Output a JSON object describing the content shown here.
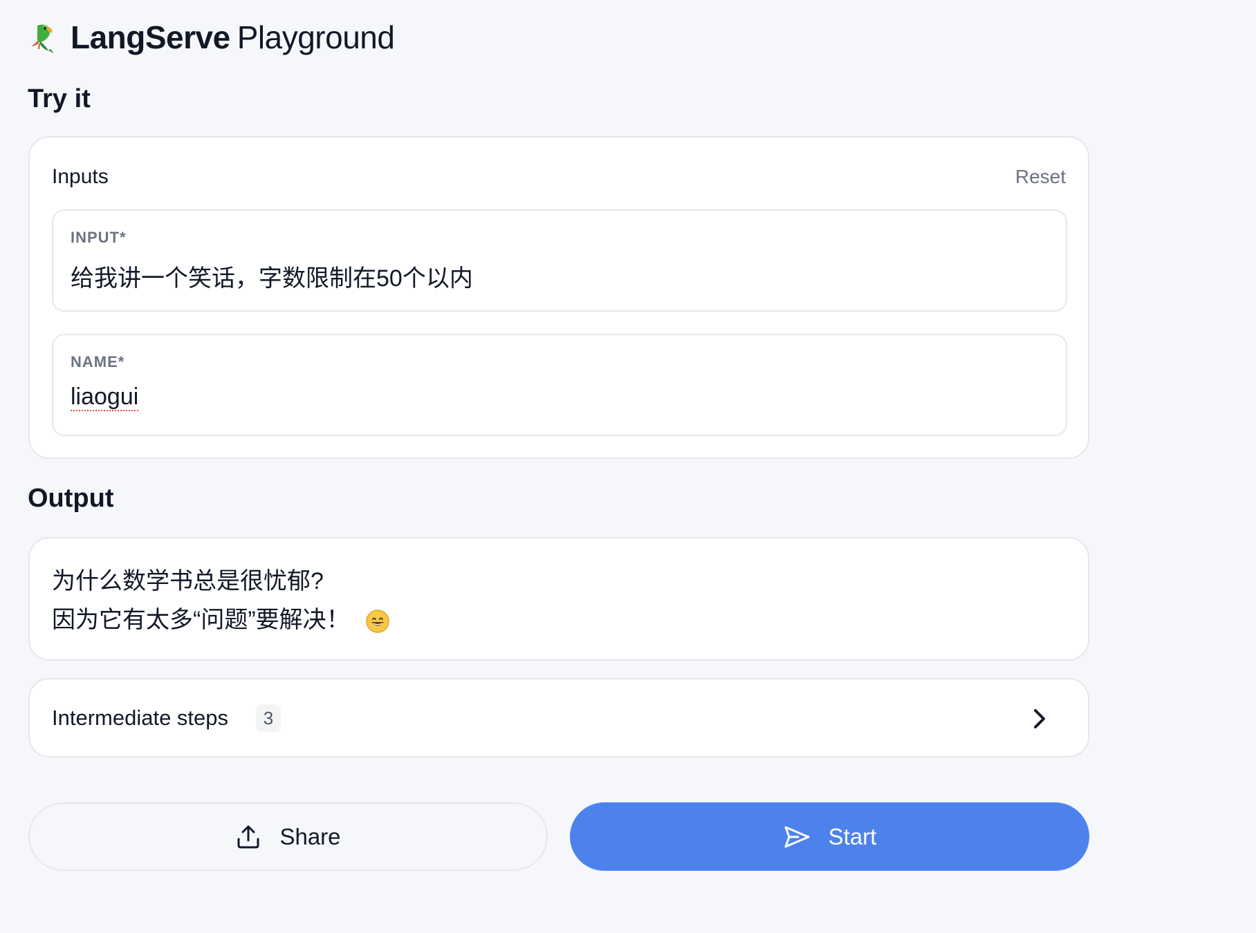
{
  "header": {
    "brand": "LangServe",
    "suffix": "Playground",
    "logo_icon": "parrot-icon"
  },
  "try_it": {
    "title": "Try it",
    "inputs_label": "Inputs",
    "reset_label": "Reset",
    "fields": [
      {
        "label": "INPUT*",
        "value": "给我讲一个笑话，字数限制在50个以内"
      },
      {
        "label": "NAME*",
        "value": "liaogui"
      }
    ]
  },
  "output": {
    "title": "Output",
    "lines": [
      "为什么数学书总是很忧郁?",
      "因为它有太多“问题”要解决！"
    ],
    "emoji": "grinning-face-emoji"
  },
  "intermediate_steps": {
    "label": "Intermediate steps",
    "count": "3",
    "icon": "chevron-right-icon"
  },
  "actions": {
    "share_label": "Share",
    "share_icon": "upload-icon",
    "start_label": "Start",
    "start_icon": "send-icon"
  },
  "colors": {
    "background": "#f5f7fb",
    "card": "#ffffff",
    "border": "#e5e7eb",
    "primary": "#4d82ed",
    "muted_text": "#6b7280"
  }
}
